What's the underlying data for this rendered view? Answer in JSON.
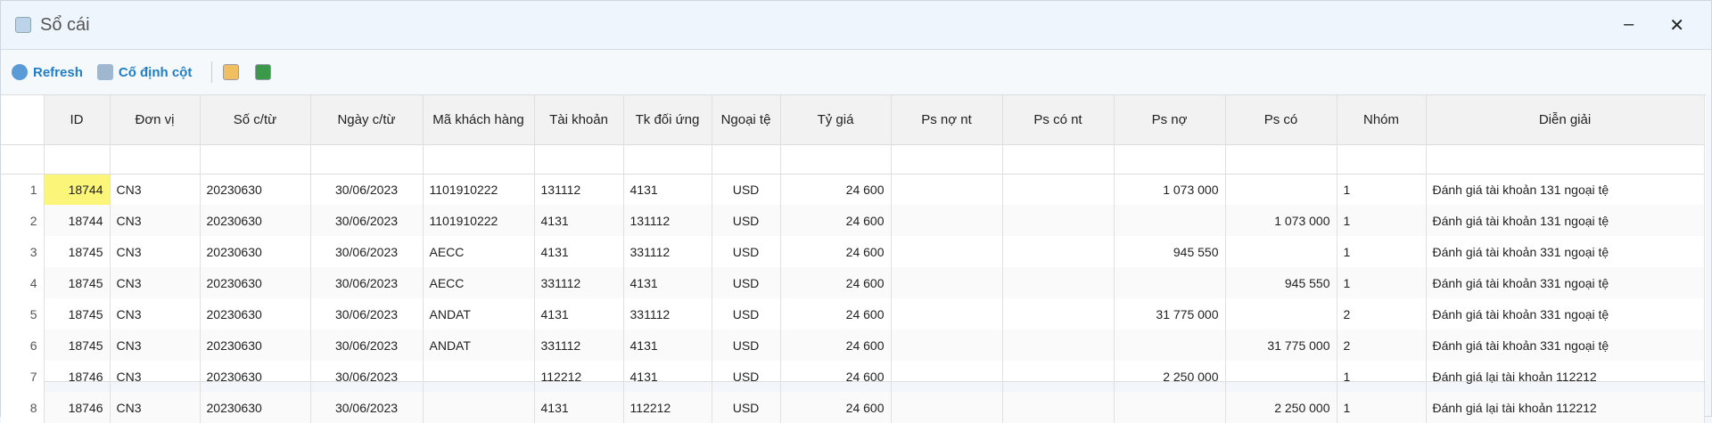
{
  "window": {
    "title": "Sổ cái",
    "minimize": "–",
    "close": "✕"
  },
  "toolbar": {
    "refresh": "Refresh",
    "freeze": "Cố định cột"
  },
  "columns": [
    "ID",
    "Đơn vị",
    "Số c/từ",
    "Ngày c/từ",
    "Mã khách hàng",
    "Tài khoản",
    "Tk đối ứng",
    "Ngoại tệ",
    "Tỷ giá",
    "Ps nợ nt",
    "Ps có nt",
    "Ps nợ",
    "Ps có",
    "Nhóm",
    "Diễn giải"
  ],
  "rows": [
    [
      "1",
      "18744",
      "CN3",
      "20230630",
      "30/06/2023",
      "1101910222",
      "131112",
      "4131",
      "USD",
      "24 600",
      "",
      "",
      "1 073 000",
      "",
      "1",
      "Đánh giá tài khoản 131 ngoại tệ"
    ],
    [
      "2",
      "18744",
      "CN3",
      "20230630",
      "30/06/2023",
      "1101910222",
      "4131",
      "131112",
      "USD",
      "24 600",
      "",
      "",
      "",
      "1 073 000",
      "1",
      "Đánh giá tài khoản 131 ngoại tệ"
    ],
    [
      "3",
      "18745",
      "CN3",
      "20230630",
      "30/06/2023",
      "AECC",
      "4131",
      "331112",
      "USD",
      "24 600",
      "",
      "",
      "945 550",
      "",
      "1",
      "Đánh giá tài khoản 331 ngoại tệ"
    ],
    [
      "4",
      "18745",
      "CN3",
      "20230630",
      "30/06/2023",
      "AECC",
      "331112",
      "4131",
      "USD",
      "24 600",
      "",
      "",
      "",
      "945 550",
      "1",
      "Đánh giá tài khoản 331 ngoại tệ"
    ],
    [
      "5",
      "18745",
      "CN3",
      "20230630",
      "30/06/2023",
      "ANDAT",
      "4131",
      "331112",
      "USD",
      "24 600",
      "",
      "",
      "31 775 000",
      "",
      "2",
      "Đánh giá tài khoản 331 ngoại tệ"
    ],
    [
      "6",
      "18745",
      "CN3",
      "20230630",
      "30/06/2023",
      "ANDAT",
      "331112",
      "4131",
      "USD",
      "24 600",
      "",
      "",
      "",
      "31 775 000",
      "2",
      "Đánh giá tài khoản 331 ngoại tệ"
    ],
    [
      "7",
      "18746",
      "CN3",
      "20230630",
      "30/06/2023",
      "",
      "112212",
      "4131",
      "USD",
      "24 600",
      "",
      "",
      "2 250 000",
      "",
      "1",
      "Đánh giá lại tài khoản 112212"
    ],
    [
      "8",
      "18746",
      "CN3",
      "20230630",
      "30/06/2023",
      "",
      "4131",
      "112212",
      "USD",
      "24 600",
      "",
      "",
      "",
      "2 250 000",
      "1",
      "Đánh giá lại tài khoản 112212"
    ]
  ],
  "colors": {
    "accent": "#1f7ec4",
    "highlight": "#fbf57a"
  }
}
